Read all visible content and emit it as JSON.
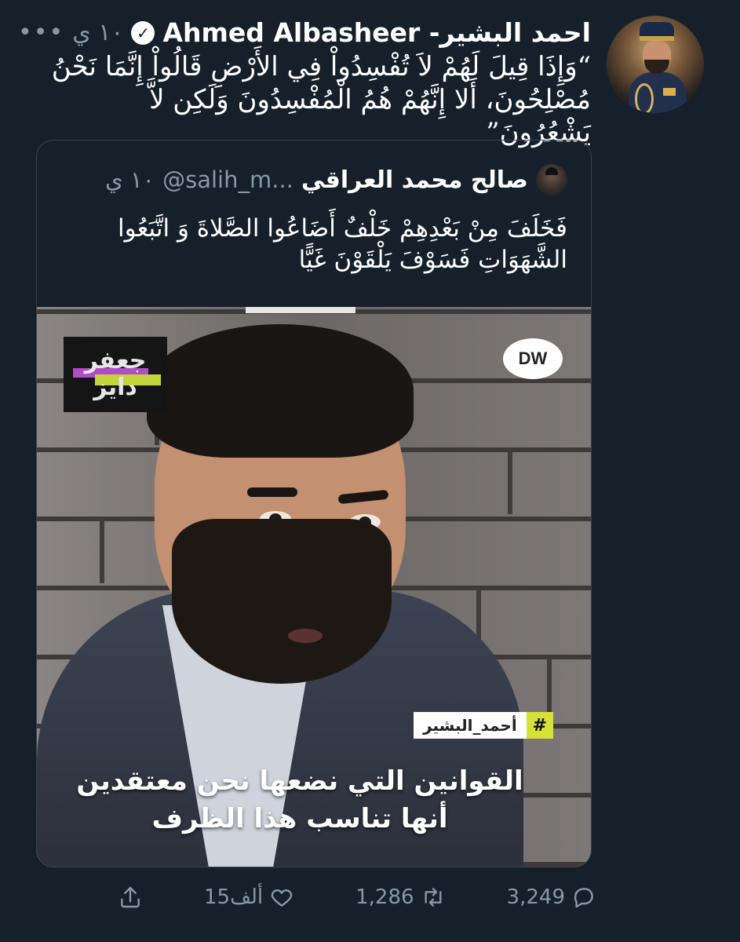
{
  "tweet": {
    "author_name": "احمد البشير- Ahmed Albasheer",
    "verified_mark": "✓",
    "time": "١٠ ي",
    "more": "•••",
    "text": "“وَإِذَا قِيلَ لَهُمْ لاَ تُفْسِدُواْ فِي الأَرْضِ قَالُواْ إِنَّمَا نَحْنُ مُصْلِحُونَ، أَلا إِنَّهُمْ هُمُ الْمُفْسِدُونَ وَلَكِن لاَّ يَشْعُرُونَ”"
  },
  "quote": {
    "name": "صالح محمد العراقي",
    "handle": "@salih_m...",
    "time": "١٠ ي",
    "text": "فَخَلَفَ مِنْ بَعْدِهِمْ خَلْفٌ أَضَاعُوا الصَّلاةَ وَ اتَّبَعُوا الشَّهَوَاتِ فَسَوْفَ يَلْقَوْنَ غَيًّا"
  },
  "media": {
    "channel_logo": "DW",
    "show_logo_line1": "جعفر",
    "show_logo_line2": "دايز",
    "hashtag_symbol": "#",
    "hashtag_text": "أحمد_البشير",
    "caption_line1": "القوانين التي نضعها نحن معتقدين",
    "caption_line2": "أنها تناسب هذا الظرف"
  },
  "actions": {
    "reply_count": "3,249",
    "retweet_count": "1,286",
    "like_count": "15ألف"
  },
  "icons": {
    "reply": "reply-icon",
    "retweet": "retweet-icon",
    "like": "heart-icon",
    "share": "share-icon"
  },
  "colors": {
    "background": "#15202b",
    "secondary_text": "#8899a6",
    "border": "#38444d",
    "hashtag_accent": "#d6e13a"
  }
}
